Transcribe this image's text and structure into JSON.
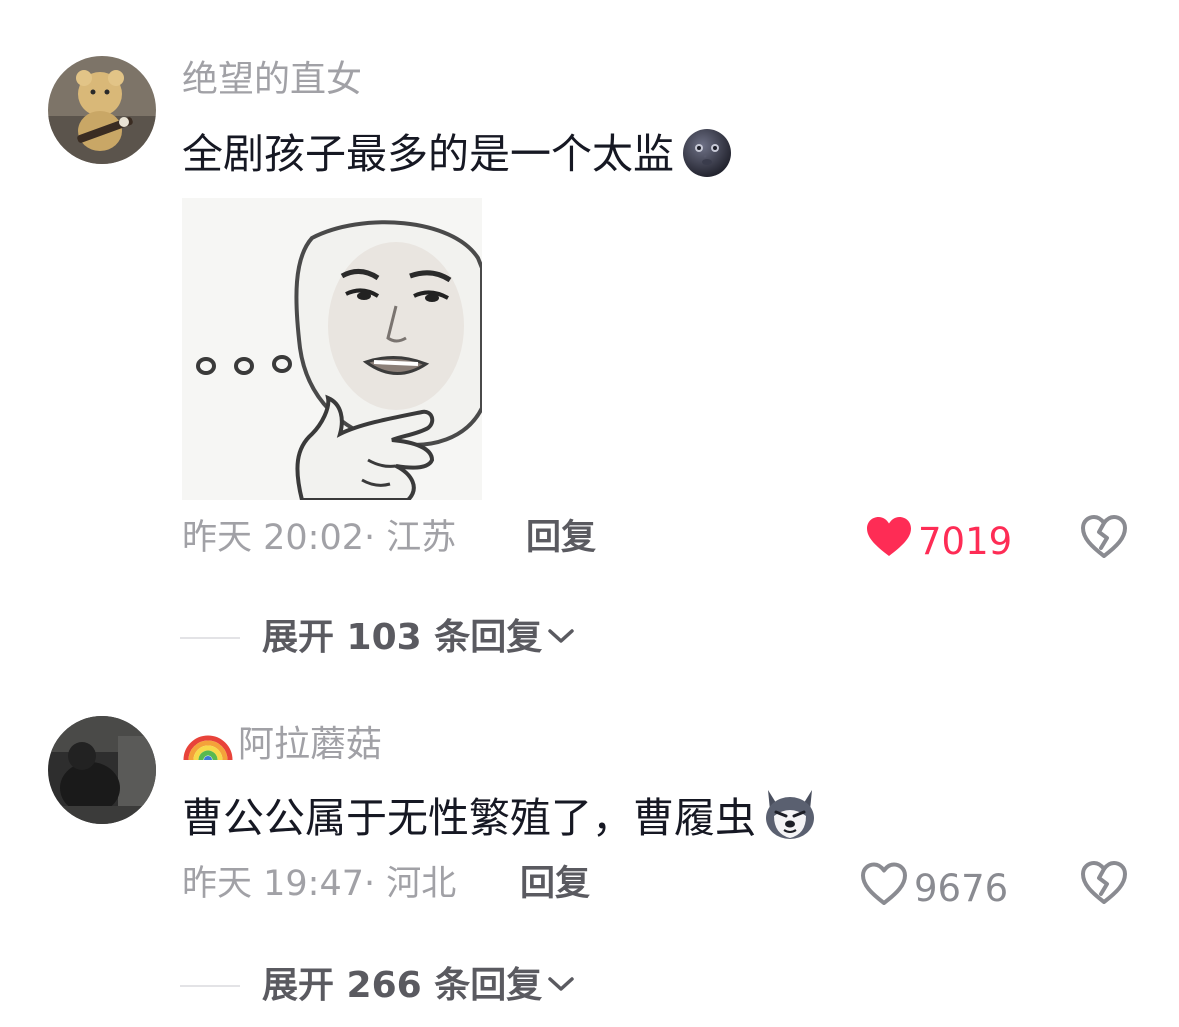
{
  "comments": [
    {
      "username": "绝望的直女",
      "username_prefix_icon": "",
      "avatar_icon": "teddy-bear-guitar-avatar",
      "text": "全剧孩子最多的是一个太监",
      "text_emoji": "dark-moon-face-emoji",
      "sticker": "thinking-meme-sticker",
      "time": "昨天 20:02",
      "location": "· 江苏",
      "reply_label": "回复",
      "like_count": "7019",
      "liked": true,
      "expand_label": "展开 103 条回复"
    },
    {
      "username": "阿拉蘑菇",
      "username_prefix_icon": "rainbow-emoji",
      "avatar_icon": "dark-photo-avatar",
      "text": "曹公公属于无性繁殖了，曹履虫",
      "text_emoji": "husky-dog-emoji",
      "time": "昨天 19:47",
      "location": "· 河北",
      "reply_label": "回复",
      "like_count": "9676",
      "liked": false,
      "expand_label": "展开 266 条回复"
    }
  ],
  "colors": {
    "like_active": "#fe2c55",
    "meta_grey": "#a1a1a6",
    "text_dark": "#161823"
  }
}
